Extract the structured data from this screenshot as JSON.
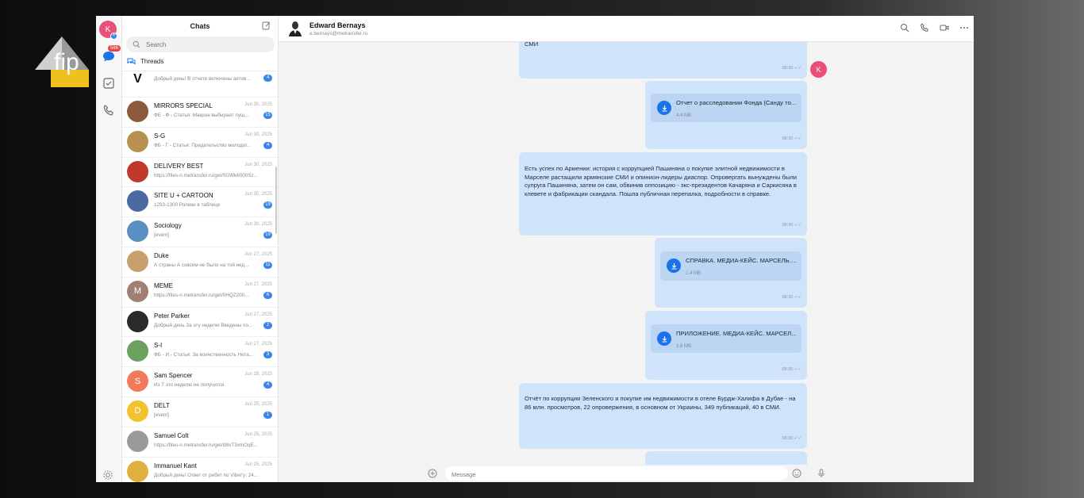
{
  "app": {
    "rail": {
      "user_initial": "K",
      "unread_badge": "566"
    },
    "list": {
      "title": "Chats",
      "search_placeholder": "Search",
      "threads_label": "Threads",
      "chats": [
        {
          "name": "",
          "initial": "V",
          "color": "#ffffff",
          "preview": "Добрый день! В отчете включены актив...",
          "date": "",
          "count": "4"
        },
        {
          "name": "MIRRORS SPECIAL",
          "initial": "",
          "color": "#8a5a3a",
          "preview": "ФБ - Ф - Статья: Макрон выбирает пуш...",
          "date": "Jun 30, 2025",
          "count": "15"
        },
        {
          "name": "S-G",
          "initial": "",
          "color": "#b89050",
          "preview": "ФБ - Г - Статья: Предательство молодог...",
          "date": "Jun 30, 2025",
          "count": "4"
        },
        {
          "name": "DELIVERY BEST",
          "initial": "",
          "color": "#c0392b",
          "preview": "https://files-n.metransfer.ru/get/0GWk6000Sz...",
          "date": "Jun 30, 2025",
          "count": ""
        },
        {
          "name": "SITE U + CARTOON",
          "initial": "",
          "color": "#4a6aa0",
          "preview": "1293-1300 Ролики в таблице",
          "date": "Jun 30, 2025",
          "count": "19"
        },
        {
          "name": "Sociology",
          "initial": "",
          "color": "#5a8fbf",
          "preview": "[event]",
          "date": "Jun 30, 2025",
          "count": "19"
        },
        {
          "name": "Duke",
          "initial": "",
          "color": "#c8a070",
          "preview": "А страны А совсем не было на той нед...",
          "date": "Jun 27, 2025",
          "count": "11"
        },
        {
          "name": "MEME",
          "initial": "M",
          "color": "#a08070",
          "preview": "https://files-n.metransfer.ru/get/0HQZ200...",
          "date": "Jun 27, 2025",
          "count": "6"
        },
        {
          "name": "Peter Parker",
          "initial": "",
          "color": "#2a2a2a",
          "preview": "Добрый день За эту неделю Введены по...",
          "date": "Jun 27, 2025",
          "count": "2"
        },
        {
          "name": "S-I",
          "initial": "",
          "color": "#6aa060",
          "preview": "ФБ - И - Статья: За воинственность Нета...",
          "date": "Jun 27, 2025",
          "count": "3"
        },
        {
          "name": "Sam Spencer",
          "initial": "S",
          "color": "#f07a5a",
          "preview": "Из Т это неделю не получится.",
          "date": "Jun 28, 2025",
          "count": "4"
        },
        {
          "name": "DELT",
          "initial": "D",
          "color": "#f2c230",
          "preview": "[event]",
          "date": "Jun 25, 2025",
          "count": "1"
        },
        {
          "name": "Samuel Colt",
          "initial": "",
          "color": "#9a9a9a",
          "preview": "https://files-n.metransfer.ru/get/d8oT3vmOqE...",
          "date": "Jun 25, 2025",
          "count": ""
        },
        {
          "name": "Immanuel Kant",
          "initial": "",
          "color": "#e0b040",
          "preview": "Добрый день! Ответ от ребят по Viber'у: 24.0...",
          "date": "Jun 25, 2025",
          "count": ""
        }
      ]
    },
    "conversation": {
      "name": "Edward Bernays",
      "email": "e.bernays@metransfer.ru",
      "right_avatar_initial": "K",
      "messages": [
        {
          "kind": "text",
          "text": "СМИ",
          "time": "08:30"
        },
        {
          "kind": "file",
          "file_name": "Отчет о расследовании Фонда (Санду то...",
          "file_size": "4.4 MB",
          "time": "08:30"
        },
        {
          "kind": "text",
          "text": "Есть успех по Армении: история с коррупцией Пашиняна о покупке элитной недвижимости в Марселе растащили армянские СМИ и опинион-лидеры диаспор. Опровергать вынуждены были супруга Пашиняна, затем он сам, обвинив оппозицию - экс-президентов Качаряна и Саркисяна в клевете и фабрикации скандала. Пошла публичная перепалка, подробности в справке.",
          "time": "08:30"
        },
        {
          "kind": "file",
          "file_name": "СПРАВКА. МЕДИА-КЕЙС. МАРСЕЛЬ.pdf",
          "file_size": "1.4 MB",
          "time": "08:30"
        },
        {
          "kind": "file",
          "file_name": "ПРИЛОЖЕНИЕ. МЕДИА-КЕЙС. МАРСЕЛ...",
          "file_size": "3.6 MB",
          "time": "08:30"
        },
        {
          "kind": "text",
          "text": "Отчёт по коррупции Зеленского и покупке им недвижимости в отеле Бурдж-Халифа в Дубае - на 86 млн. просмотров, 22 опровержения, в основном от Украины, 349 публикаций, 40 в СМИ.",
          "time": "08:30"
        }
      ],
      "composer_placeholder": "Message"
    },
    "logo_text": "fip"
  }
}
